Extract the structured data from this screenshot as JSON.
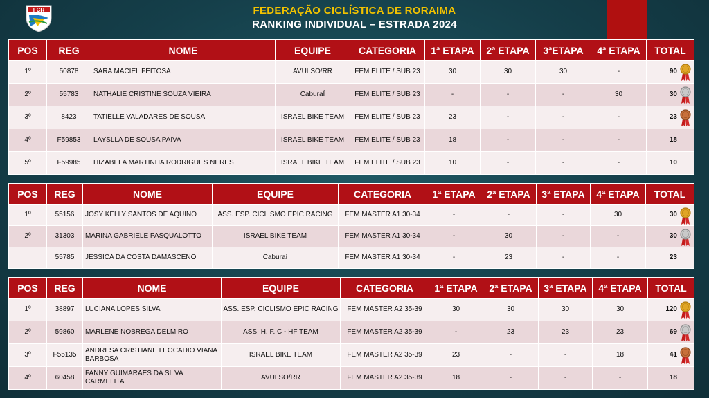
{
  "header": {
    "title": "FEDERAÇÃO CICLÍSTICA DE RORAIMA",
    "subtitle": "RANKING INDIVIDUAL – ESTRADA 2024",
    "logo_text": "FCR"
  },
  "colors": {
    "header_red": "#b11016",
    "title_yellow": "#f2c200",
    "bg_teal": "#1a4a55"
  },
  "tables": [
    {
      "headers": [
        "POS",
        "REG",
        "NOME",
        "EQUIPE",
        "CATEGORIA",
        "1ª ETAPA",
        "2ª ETAPA",
        "3ªETAPA",
        "4ª ETAPA",
        "TOTAL"
      ],
      "rows": [
        {
          "pos": "1º",
          "reg": "50878",
          "nome": "SARA MACIEL FEITOSA",
          "equipe": "AVULSO/RR",
          "categoria": "FEM ELITE / SUB 23",
          "e1": "30",
          "e2": "30",
          "e3": "30",
          "e4": "-",
          "total": "90",
          "medal": "gold"
        },
        {
          "pos": "2º",
          "reg": "55783",
          "nome": "NATHALIE CRISTINE SOUZA VIEIRA",
          "equipe": "CaburaÍ",
          "categoria": "FEM ELITE / SUB 23",
          "e1": "-",
          "e2": "-",
          "e3": "-",
          "e4": "30",
          "total": "30",
          "medal": "silver"
        },
        {
          "pos": "3º",
          "reg": "8423",
          "nome": "TATIELLE VALADARES DE SOUSA",
          "equipe": "ISRAEL BIKE TEAM",
          "categoria": "FEM ELITE / SUB 23",
          "e1": "23",
          "e2": "-",
          "e3": "-",
          "e4": "-",
          "total": "23",
          "medal": "bronze"
        },
        {
          "pos": "4º",
          "reg": "F59853",
          "nome": "LAYSLLA DE SOUSA PAIVA",
          "equipe": "ISRAEL BIKE TEAM",
          "categoria": "FEM ELITE / SUB 23",
          "e1": "18",
          "e2": "-",
          "e3": "-",
          "e4": "-",
          "total": "18",
          "medal": ""
        },
        {
          "pos": "5º",
          "reg": "F59985",
          "nome": "HIZABELA MARTINHA RODRIGUES NERES",
          "equipe": "ISRAEL BIKE TEAM",
          "categoria": "FEM ELITE / SUB 23",
          "e1": "10",
          "e2": "-",
          "e3": "-",
          "e4": "-",
          "total": "10",
          "medal": ""
        }
      ]
    },
    {
      "headers": [
        "POS",
        "REG",
        "NOME",
        "EQUIPE",
        "CATEGORIA",
        "1ª ETAPA",
        "2ª ETAPA",
        "3ª ETAPA",
        "4ª ETAPA",
        "TOTAL"
      ],
      "rows": [
        {
          "pos": "1º",
          "reg": "55156",
          "nome": "JOSY KELLY SANTOS DE AQUINO",
          "equipe": "ASS. ESP. CICLISMO EPIC RACING",
          "categoria": "FEM MASTER A1 30-34",
          "e1": "-",
          "e2": "-",
          "e3": "-",
          "e4": "30",
          "total": "30",
          "medal": "gold"
        },
        {
          "pos": "2º",
          "reg": "31303",
          "nome": "MARINA GABRIELE PASQUALOTTO",
          "equipe": "ISRAEL BIKE TEAM",
          "categoria": "FEM MASTER A1 30-34",
          "e1": "-",
          "e2": "30",
          "e3": "-",
          "e4": "-",
          "total": "30",
          "medal": "silver"
        },
        {
          "pos": "",
          "reg": "55785",
          "nome": "JESSICA DA COSTA DAMASCENO",
          "equipe": "Caburaí",
          "categoria": "FEM MASTER A1 30-34",
          "e1": "-",
          "e2": "23",
          "e3": "-",
          "e4": "-",
          "total": "23",
          "medal": ""
        }
      ]
    },
    {
      "headers": [
        "POS",
        "REG",
        "NOME",
        "EQUIPE",
        "CATEGORIA",
        "1ª ETAPA",
        "2ª ETAPA",
        "3ª ETAPA",
        "4ª ETAPA",
        "TOTAL"
      ],
      "rows": [
        {
          "pos": "1º",
          "reg": "38897",
          "nome": "LUCIANA LOPES  SILVA",
          "equipe": "ASS. ESP. CICLISMO EPIC RACING",
          "categoria": "FEM MASTER A2 35-39",
          "e1": "30",
          "e2": "30",
          "e3": "30",
          "e4": "30",
          "total": "120",
          "medal": "gold"
        },
        {
          "pos": "2º",
          "reg": "59860",
          "nome": "MARLENE NOBREGA DELMIRO",
          "equipe": "ASS. H. F. C - HF TEAM",
          "categoria": "FEM MASTER A2 35-39",
          "e1": "-",
          "e2": "23",
          "e3": "23",
          "e4": "23",
          "total": "69",
          "medal": "silver"
        },
        {
          "pos": "3º",
          "reg": "F55135",
          "nome": "ANDRESA CRISTIANE LEOCADIO VIANA BARBOSA",
          "equipe": "ISRAEL BIKE TEAM",
          "categoria": "FEM MASTER A2 35-39",
          "e1": "23",
          "e2": "-",
          "e3": "-",
          "e4": "18",
          "total": "41",
          "medal": "bronze"
        },
        {
          "pos": "4º",
          "reg": "60458",
          "nome": "FANNY GUIMARAES DA SILVA CARMELITA",
          "equipe": "AVULSO/RR",
          "categoria": "FEM MASTER A2 35-39",
          "e1": "18",
          "e2": "-",
          "e3": "-",
          "e4": "-",
          "total": "18",
          "medal": ""
        }
      ]
    }
  ]
}
